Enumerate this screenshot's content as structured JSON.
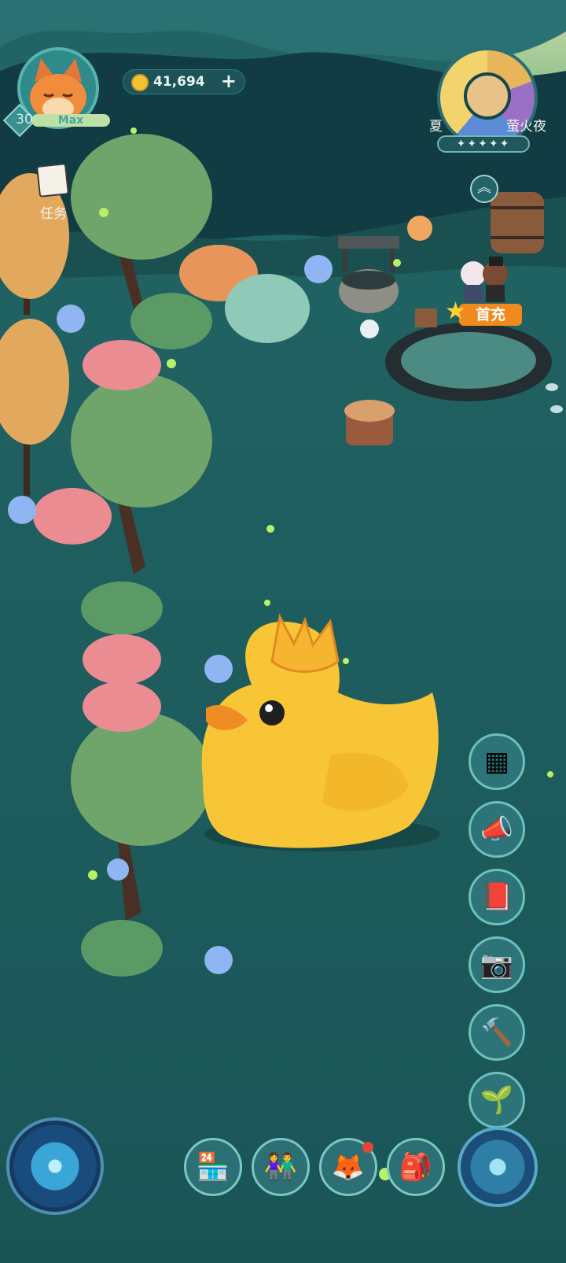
{
  "player": {
    "level": "30",
    "level_status": "Max",
    "avatar_icon": "fox-avatar-icon"
  },
  "currency": {
    "coins": "41,694",
    "add_label": "+"
  },
  "tasks": {
    "label": "任务"
  },
  "season": {
    "left_label": "夏",
    "right_label": "萤火夜",
    "stars": "✦✦✦✦✦"
  },
  "first_charge": {
    "label": "首充"
  },
  "side_buttons": [
    {
      "icon": "apps-grid-icon",
      "glyph": "▦"
    },
    {
      "icon": "megaphone-icon",
      "glyph": "📣"
    },
    {
      "icon": "flower-book-icon",
      "glyph": "📕"
    },
    {
      "icon": "camera-icon",
      "glyph": "📷"
    },
    {
      "icon": "hammer-icon",
      "glyph": "🔨"
    },
    {
      "icon": "sprout-icon",
      "glyph": "🌱"
    }
  ],
  "bottom_buttons": [
    {
      "icon": "shop-icon",
      "glyph": "🏪"
    },
    {
      "icon": "friends-icon",
      "glyph": "👫"
    },
    {
      "icon": "fox-pet-icon",
      "glyph": "🦊"
    },
    {
      "icon": "backpack-icon",
      "glyph": "🎒"
    }
  ],
  "colors": {
    "ground": "#1f5c5c",
    "accent": "#f08a1c",
    "coin": "#f2c236"
  }
}
